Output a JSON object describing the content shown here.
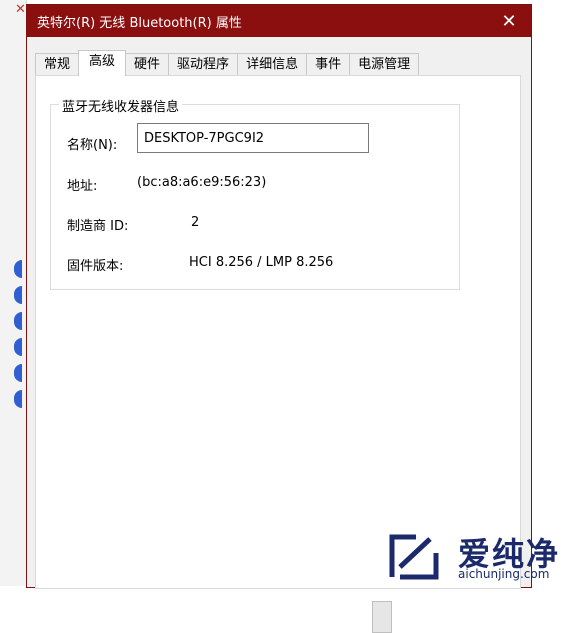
{
  "dialog": {
    "title": "英特尔(R) 无线 Bluetooth(R) 属性",
    "close_glyph": "✕"
  },
  "tabs": [
    {
      "label": "常规"
    },
    {
      "label": "高级",
      "active": true
    },
    {
      "label": "硬件"
    },
    {
      "label": "驱动程序"
    },
    {
      "label": "详细信息"
    },
    {
      "label": "事件"
    },
    {
      "label": "电源管理"
    }
  ],
  "group": {
    "title": "蓝牙无线收发器信息",
    "name_label": "名称(N):",
    "name_value": "DESKTOP-7PGC9I2",
    "address_label": "地址:",
    "address_value": "(bc:a8:a6:e9:56:23)",
    "manufacturer_label": "制造商 ID:",
    "manufacturer_value": "2",
    "firmware_label": "固件版本:",
    "firmware_value": "HCI 8.256  /  LMP 8.256"
  },
  "watermark": {
    "brand": "爱纯净",
    "site": "aichunjing.com"
  },
  "colors": {
    "titlebar": "#8b0f0f",
    "watermark": "#1b2a6b"
  }
}
